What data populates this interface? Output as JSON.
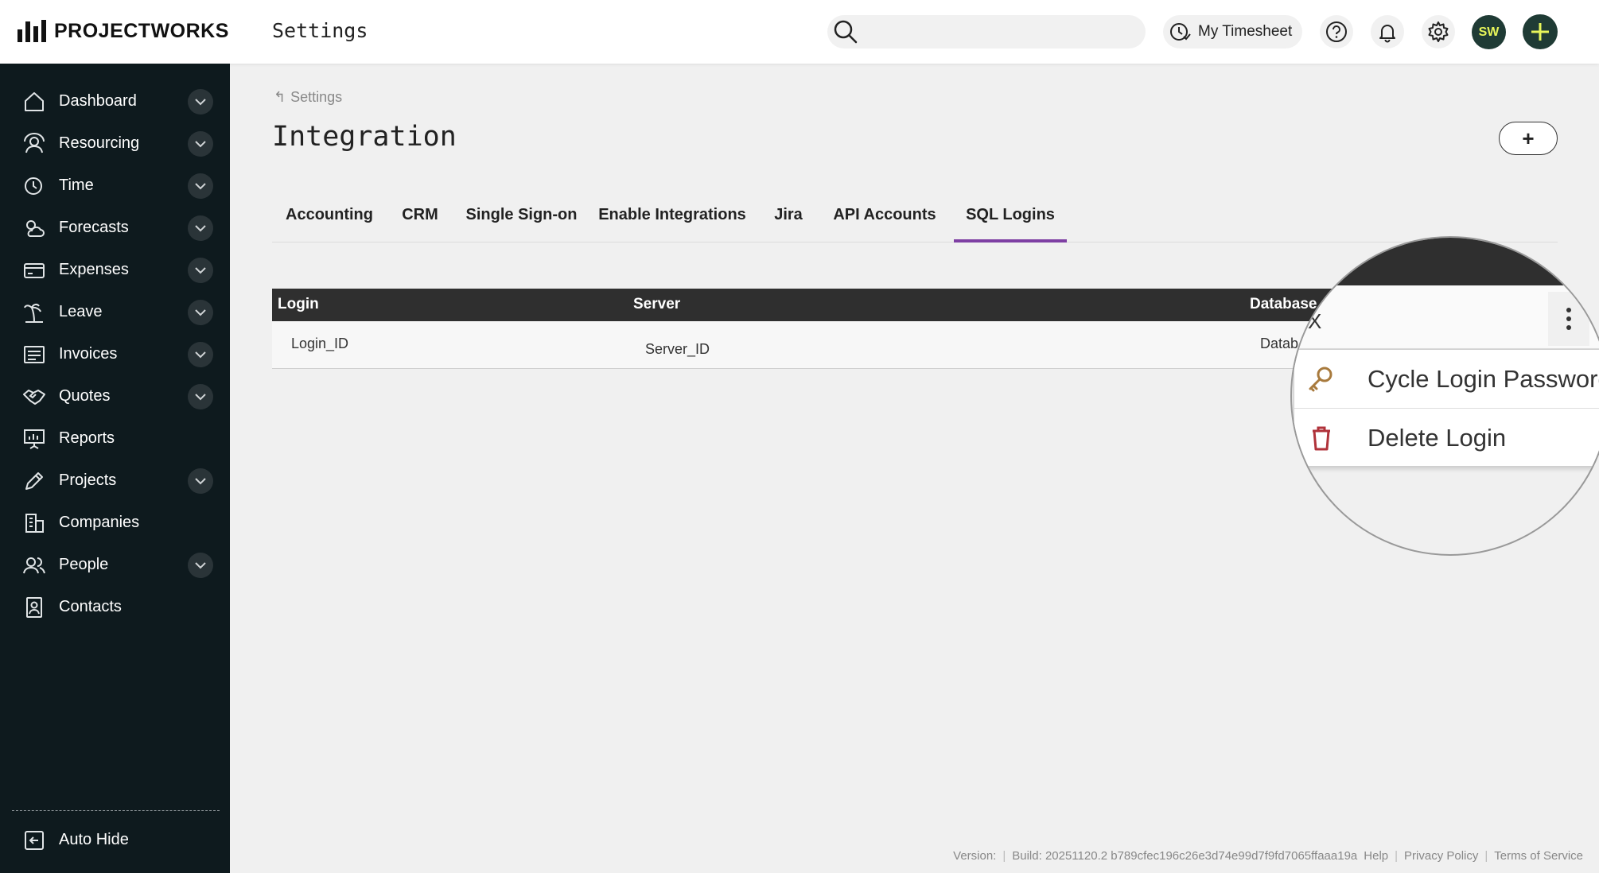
{
  "app": {
    "logo_text": "PROJECTWORKS",
    "page_heading": "Settings"
  },
  "topbar": {
    "search_placeholder": "",
    "timesheet_label": "My Timesheet",
    "avatar_initials": "SW"
  },
  "sidebar": {
    "items": [
      {
        "label": "Dashboard",
        "icon": "home-icon",
        "expandable": true
      },
      {
        "label": "Resourcing",
        "icon": "resourcing-icon",
        "expandable": true
      },
      {
        "label": "Time",
        "icon": "clock-icon",
        "expandable": true
      },
      {
        "label": "Forecasts",
        "icon": "weather-icon",
        "expandable": true
      },
      {
        "label": "Expenses",
        "icon": "card-icon",
        "expandable": true
      },
      {
        "label": "Leave",
        "icon": "palm-tree-icon",
        "expandable": true
      },
      {
        "label": "Invoices",
        "icon": "invoice-icon",
        "expandable": true
      },
      {
        "label": "Quotes",
        "icon": "handshake-icon",
        "expandable": true
      },
      {
        "label": "Reports",
        "icon": "presentation-icon",
        "expandable": false
      },
      {
        "label": "Projects",
        "icon": "pencil-icon",
        "expandable": true
      },
      {
        "label": "Companies",
        "icon": "building-icon",
        "expandable": false
      },
      {
        "label": "People",
        "icon": "people-icon",
        "expandable": true
      },
      {
        "label": "Contacts",
        "icon": "contact-card-icon",
        "expandable": false
      }
    ],
    "autohide_label": "Auto Hide"
  },
  "main": {
    "breadcrumb": "Settings",
    "title": "Integration",
    "add_button_label": "+",
    "tabs": [
      {
        "label": "Accounting",
        "active": false
      },
      {
        "label": "CRM",
        "active": false
      },
      {
        "label": "Single Sign-on",
        "active": false
      },
      {
        "label": "Enable Integrations",
        "active": false
      },
      {
        "label": "Jira",
        "active": false
      },
      {
        "label": "API Accounts",
        "active": false
      },
      {
        "label": "SQL Logins",
        "active": true
      }
    ],
    "table": {
      "headers": [
        "Login",
        "Server",
        "Database"
      ],
      "rows": [
        {
          "login": "Login_ID",
          "server": "Server_ID",
          "database": "Datab"
        }
      ]
    }
  },
  "context_menu": {
    "close_label": "X",
    "items": [
      {
        "label": "Cycle Login Password",
        "icon": "key-icon"
      },
      {
        "label": "Delete Login",
        "icon": "trash-icon"
      }
    ]
  },
  "footer": {
    "version": "Version:",
    "build": "Build: 20251120.2 b789cfec196c26e3d74e99d7f9fd7065ffaaa19a",
    "help": "Help",
    "privacy": "Privacy Policy",
    "terms": "Terms of Service"
  },
  "colors": {
    "sidebar_bg": "#0e1a1e",
    "accent_tab": "#7e3fa3",
    "avatar_bg": "#1f3b35",
    "avatar_text": "#e7f55a",
    "table_header_bg": "#2f2f2f",
    "key_icon": "#a87a3d",
    "trash_icon": "#b0323a"
  }
}
